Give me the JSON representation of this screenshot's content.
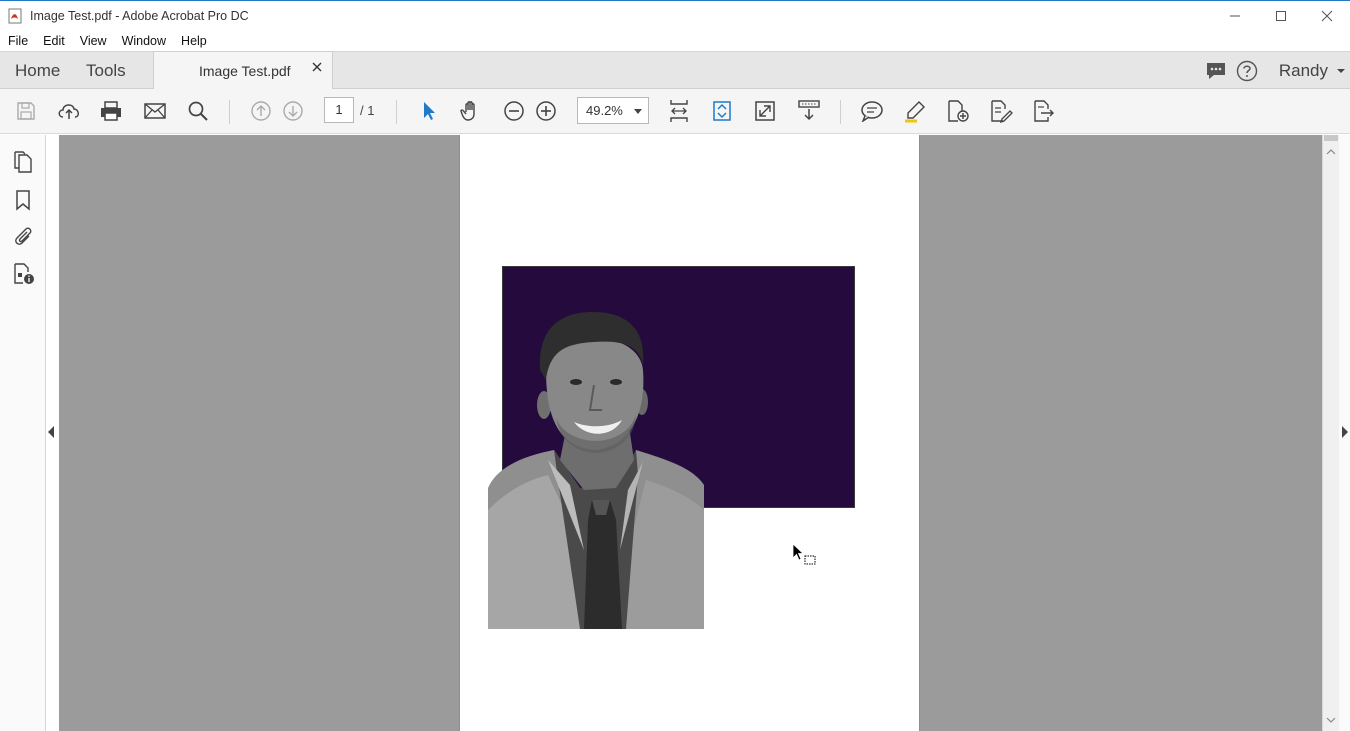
{
  "window": {
    "title": "Image Test.pdf - Adobe Acrobat Pro DC",
    "controls": {
      "minimize": "minimize",
      "maximize": "maximize",
      "close": "close"
    }
  },
  "menu": {
    "items": [
      "File",
      "Edit",
      "View",
      "Window",
      "Help"
    ]
  },
  "tabs": {
    "home": "Home",
    "tools": "Tools",
    "document": "Image Test.pdf",
    "user": "Randy"
  },
  "toolbar": {
    "page_current": "1",
    "page_total": "/ 1",
    "zoom": "49.2%"
  },
  "icons": {
    "left_toolbar": [
      "save-icon",
      "upload-cloud-icon",
      "print-icon",
      "email-icon",
      "search-icon"
    ],
    "page_nav": [
      "page-up-icon",
      "page-down-icon"
    ],
    "view_tools": [
      "select-arrow-icon",
      "hand-icon",
      "zoom-out-icon",
      "zoom-in-icon"
    ],
    "right_tools": [
      "comment-icon",
      "highlight-icon",
      "add-pdf-icon",
      "fill-sign-icon",
      "export-pdf-icon"
    ],
    "rail": [
      "pages-icon",
      "bookmark-icon",
      "attachment-icon",
      "document-properties-icon"
    ]
  },
  "colors": {
    "accent": "#1f7ac8",
    "purple_block": "#250a3e",
    "viewer_bg": "#9b9b9b"
  }
}
